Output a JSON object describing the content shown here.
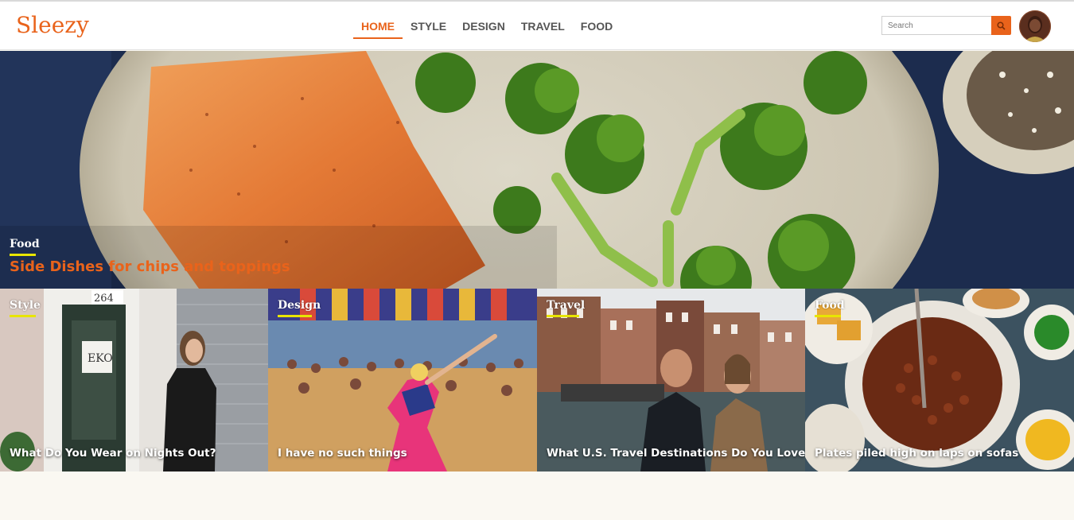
{
  "brand": {
    "logo": "Sleezy",
    "accent": "#e9631b",
    "highlight": "#e8e500"
  },
  "nav": {
    "items": [
      {
        "label": "HOME",
        "active": true
      },
      {
        "label": "STYLE",
        "active": false
      },
      {
        "label": "DESIGN",
        "active": false
      },
      {
        "label": "TRAVEL",
        "active": false
      },
      {
        "label": "FOOD",
        "active": false
      }
    ]
  },
  "search": {
    "placeholder": "Search",
    "icon": "search-icon"
  },
  "user": {
    "avatar_icon": "avatar"
  },
  "hero": {
    "category": "Food",
    "title": "Side Dishes for chips and toppings"
  },
  "cards": [
    {
      "category": "Style",
      "title": "What Do You Wear on Nights Out?"
    },
    {
      "category": "Design",
      "title": "I have no such things"
    },
    {
      "category": "Travel",
      "title": "What U.S. Travel Destinations Do You Love?"
    },
    {
      "category": "Food",
      "title": "Plates piled high on laps on sofas"
    }
  ]
}
